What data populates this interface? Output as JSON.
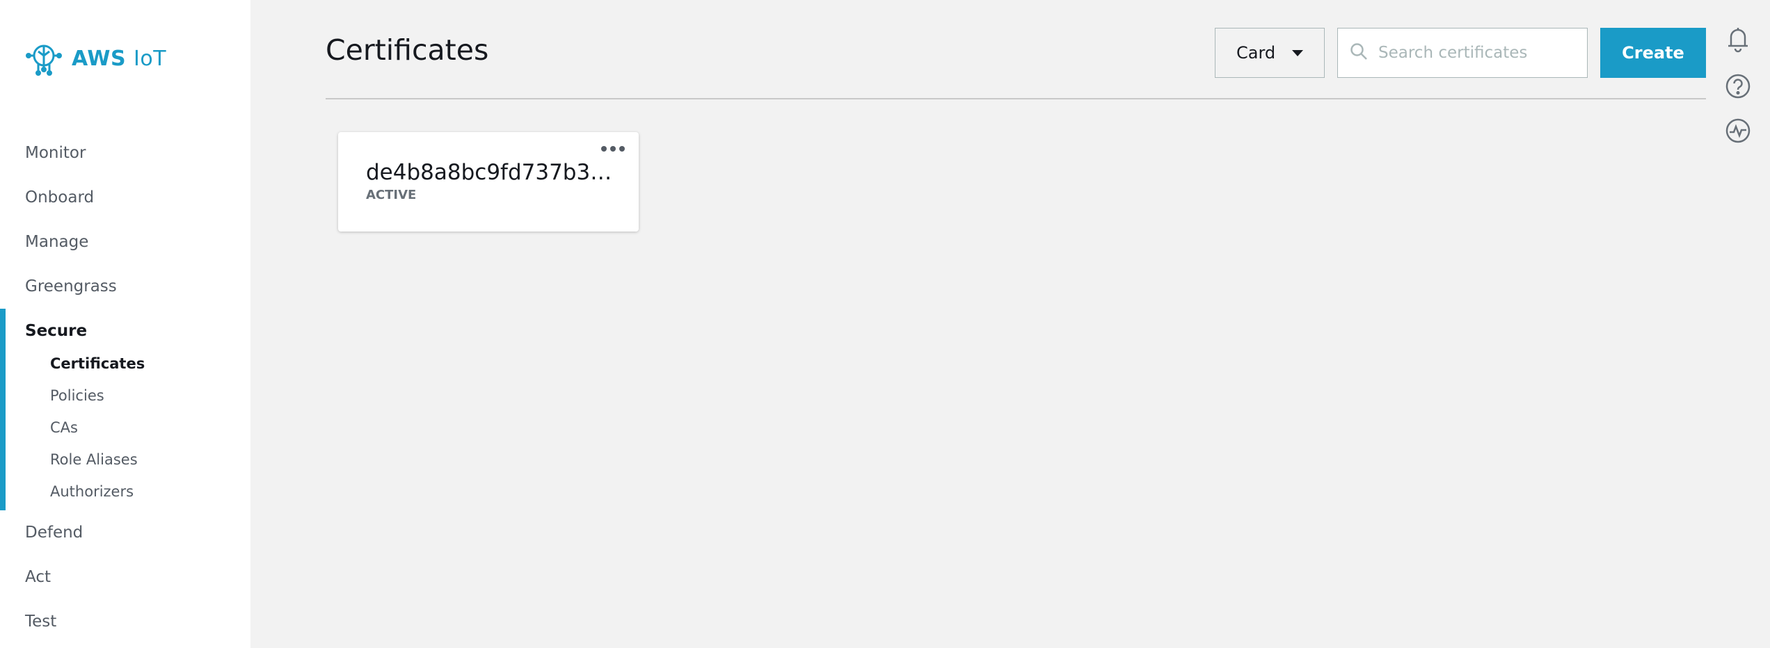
{
  "brand": {
    "name_bold": "AWS",
    "name_light": "IoT"
  },
  "nav": {
    "items_top": [
      "Monitor",
      "Onboard",
      "Manage",
      "Greengrass"
    ],
    "secure": {
      "label": "Secure",
      "children": [
        "Certificates",
        "Policies",
        "CAs",
        "Role Aliases",
        "Authorizers"
      ]
    },
    "items_bottom": [
      "Defend",
      "Act",
      "Test"
    ]
  },
  "header": {
    "title": "Certificates",
    "view_select": "Card",
    "search_placeholder": "Search certificates",
    "create_label": "Create"
  },
  "certificates": [
    {
      "id": "de4b8a8bc9fd737b35…",
      "status": "ACTIVE"
    }
  ],
  "colors": {
    "accent": "#1a9bc7",
    "background": "#f2f2f2"
  },
  "icons": [
    "iot-logo-icon",
    "search-icon",
    "bell-icon",
    "help-icon",
    "activity-icon",
    "more-options-icon",
    "caret-down-icon"
  ]
}
